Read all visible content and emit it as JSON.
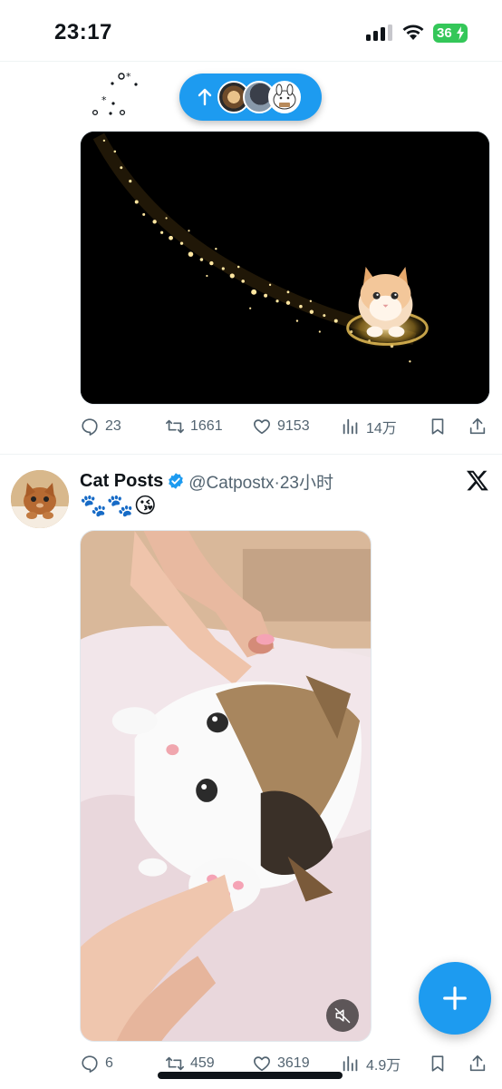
{
  "status_bar": {
    "time": "23:17",
    "battery": "36",
    "icons": [
      "signal-icon",
      "wifi-icon",
      "battery-icon"
    ]
  },
  "new_posts_pill": {
    "icon": "arrow-up-icon",
    "avatars": [
      "avatar-1",
      "avatar-2",
      "avatar-3"
    ]
  },
  "post_1": {
    "media": "sparkle-kitten-image",
    "actions": {
      "replies": "23",
      "reposts": "1661",
      "likes": "9153",
      "views": "14万"
    }
  },
  "post_2": {
    "author_name": "Cat Posts",
    "handle_time": "@Catpostx·23小时",
    "text": "🐾🐾😘",
    "media": "kitten-video",
    "actions": {
      "replies": "6",
      "reposts": "459",
      "likes": "3619",
      "views": "4.9万"
    }
  },
  "colors": {
    "accent": "#1d9bf0",
    "muted_text": "#536471",
    "battery": "#34c759"
  },
  "fab": {
    "icon": "plus-icon"
  }
}
